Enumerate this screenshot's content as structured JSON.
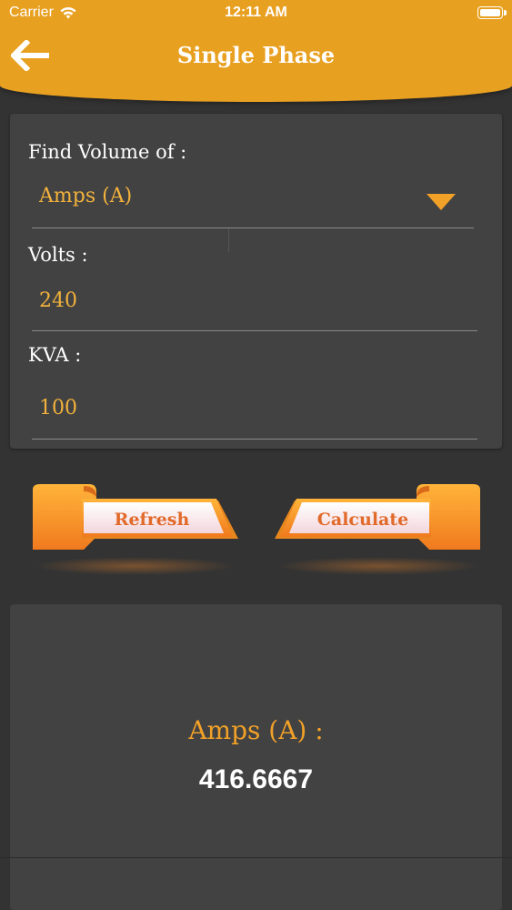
{
  "status_bar": {
    "carrier": "Carrier",
    "time": "12:11 AM"
  },
  "header": {
    "title": "Single Phase",
    "back_icon": "arrow-left-icon",
    "color": "#e8a020"
  },
  "form": {
    "find_label": "Find Volume of :",
    "selected_option": "Amps (A)",
    "volts_label": "Volts :",
    "volts_value": "240",
    "kva_label": "KVA :",
    "kva_value": "100"
  },
  "buttons": {
    "refresh_label": "Refresh",
    "calculate_label": "Calculate"
  },
  "result": {
    "label": "Amps (A) :",
    "value": "416.6667"
  },
  "colors": {
    "accent": "#f2a128",
    "background": "#333333",
    "card": "#424242"
  }
}
